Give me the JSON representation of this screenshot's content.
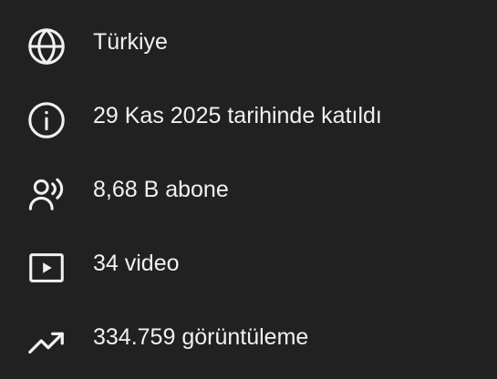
{
  "colors": {
    "background": "#212121",
    "text": "#f1f1f1",
    "icon": "#f1f1f1"
  },
  "about": {
    "items": [
      {
        "icon": "globe-icon",
        "text": "Türkiye"
      },
      {
        "icon": "info-icon",
        "text": "29 Kas 2025 tarihinde katıldı"
      },
      {
        "icon": "subscribers-icon",
        "text": "8,68 B abone"
      },
      {
        "icon": "video-icon",
        "text": "34 video"
      },
      {
        "icon": "trending-icon",
        "text": "334.759 görüntüleme"
      }
    ]
  }
}
